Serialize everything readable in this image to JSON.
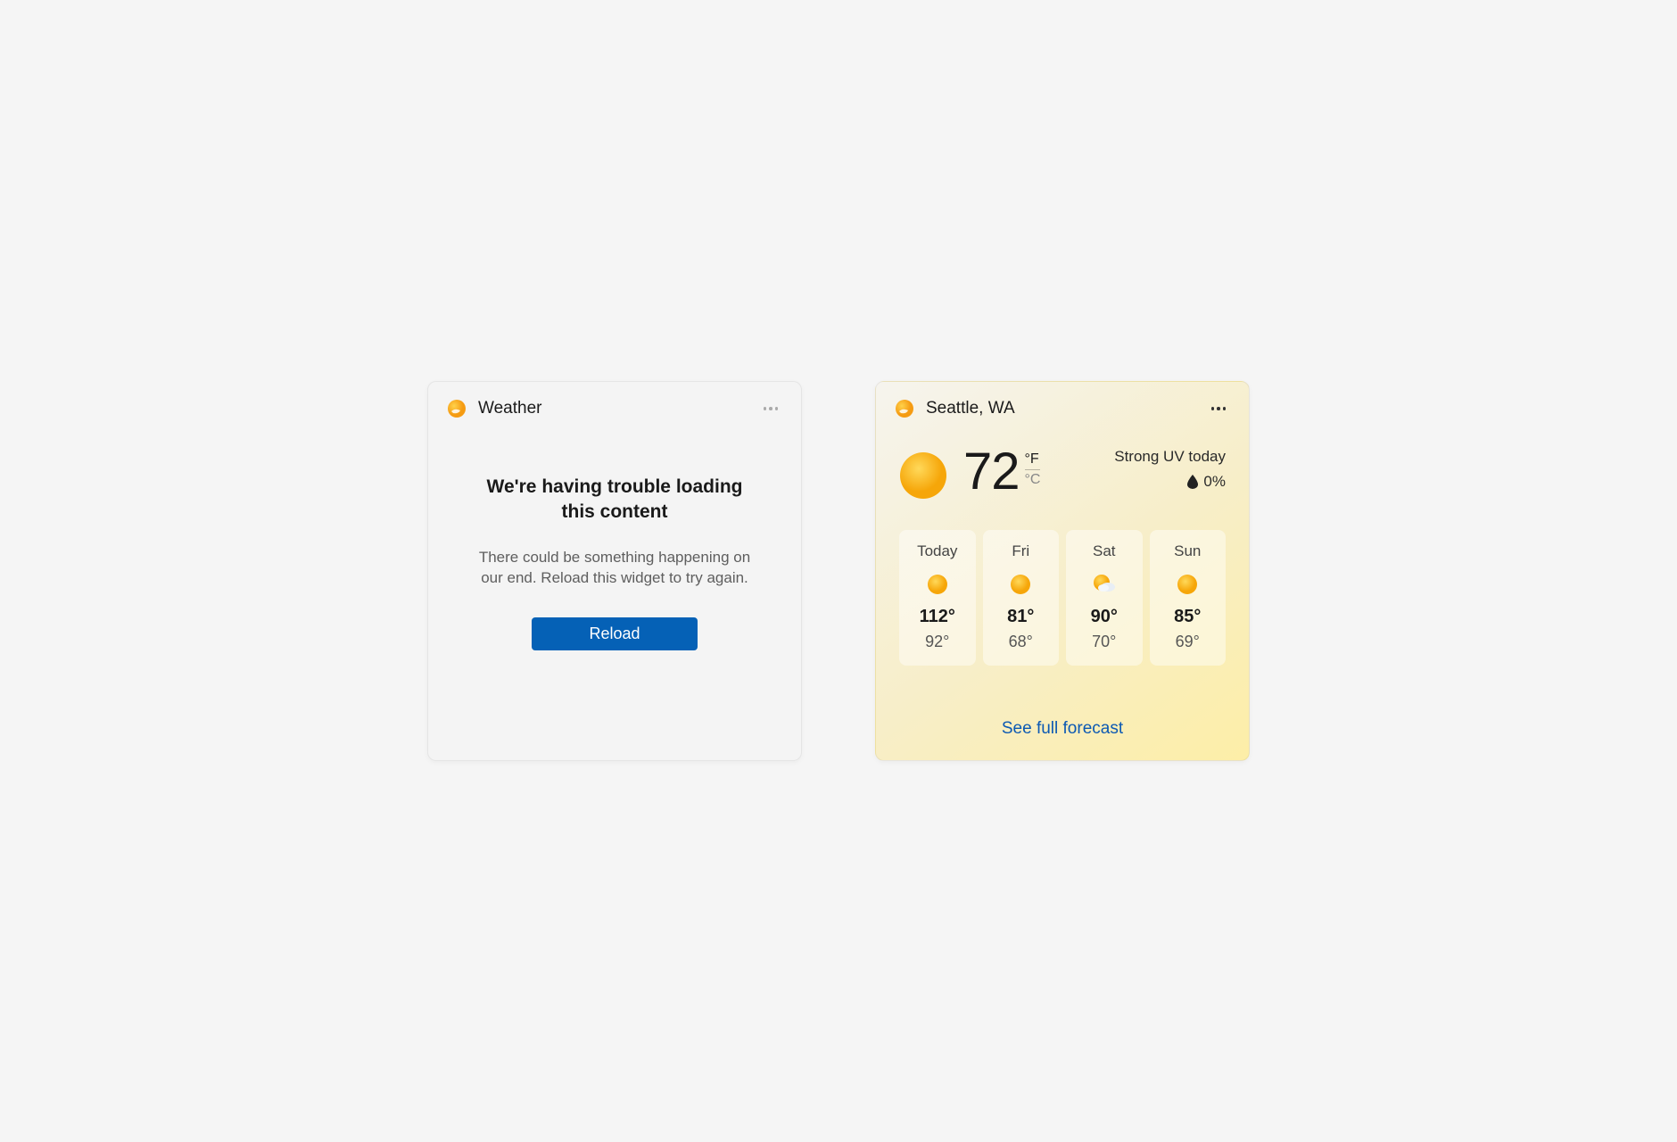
{
  "error_card": {
    "title": "Weather",
    "heading": "We're having trouble loading this content",
    "message": "There could be something happening on our end. Reload this widget to try again.",
    "reload_label": "Reload"
  },
  "weather_card": {
    "location": "Seattle, WA",
    "current_temp": "72",
    "unit_f": "°F",
    "unit_c": "°C",
    "uv_text": "Strong UV today",
    "humidity": "0%",
    "forecast_link": "See full forecast",
    "days": [
      {
        "label": "Today",
        "high": "112°",
        "low": "92°",
        "icon": "sun"
      },
      {
        "label": "Fri",
        "high": "81°",
        "low": "68°",
        "icon": "sun"
      },
      {
        "label": "Sat",
        "high": "90°",
        "low": "70°",
        "icon": "partly"
      },
      {
        "label": "Sun",
        "high": "85°",
        "low": "69°",
        "icon": "sun"
      }
    ]
  }
}
